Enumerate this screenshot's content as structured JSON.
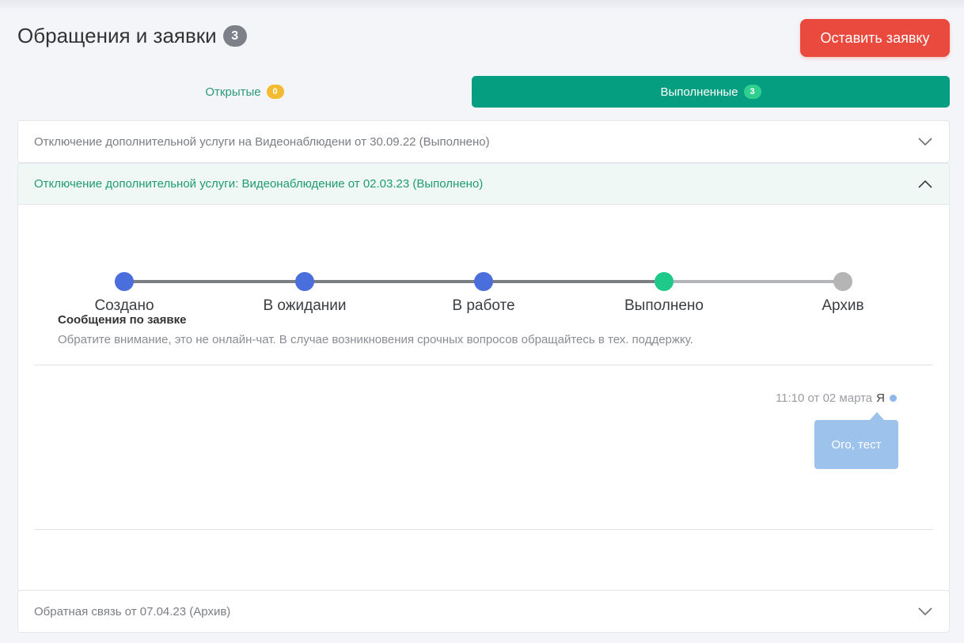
{
  "header": {
    "title": "Обращения и заявки",
    "total_count": "3",
    "cta_label": "Оставить заявку"
  },
  "tabs": [
    {
      "label": "Открытые",
      "count": "0",
      "active": false
    },
    {
      "label": "Выполненные",
      "count": "3",
      "active": true
    }
  ],
  "requests": [
    {
      "title": "Отключение дополнительной услуги на Видеонаблюдени от 30.09.22 (Выполнено)",
      "expanded": false
    },
    {
      "title": "Отключение дополнительной услуги: Видеонаблюдение от 02.03.23 (Выполнено)",
      "expanded": true
    },
    {
      "title": "Обратная связь от 07.04.23 (Архив)",
      "expanded": false
    }
  ],
  "progress": {
    "steps": [
      {
        "label": "Создано",
        "state": "done"
      },
      {
        "label": "В ожидании",
        "state": "done"
      },
      {
        "label": "В работе",
        "state": "done"
      },
      {
        "label": "Выполнено",
        "state": "current"
      },
      {
        "label": "Архив",
        "state": "future"
      }
    ]
  },
  "messages_section": {
    "heading": "Сообщения по заявке",
    "note": "Обратите внимание, это не онлайн-чат. В случае возникновения срочных вопросов обращайтесь в тех. поддержку."
  },
  "messages": [
    {
      "time": "11:10 от 02 марта",
      "author": "Я",
      "text": "Ого, тест"
    }
  ],
  "colors": {
    "accent_green": "#069e80",
    "cta_red": "#ea4a3d",
    "step_done": "#4a6fdc",
    "step_current": "#1fc98a",
    "step_future": "#b5b5b5",
    "bubble": "#9dc2ec"
  },
  "icons": {
    "collapsed": "chevron-down-icon",
    "expanded": "chevron-up-icon"
  }
}
